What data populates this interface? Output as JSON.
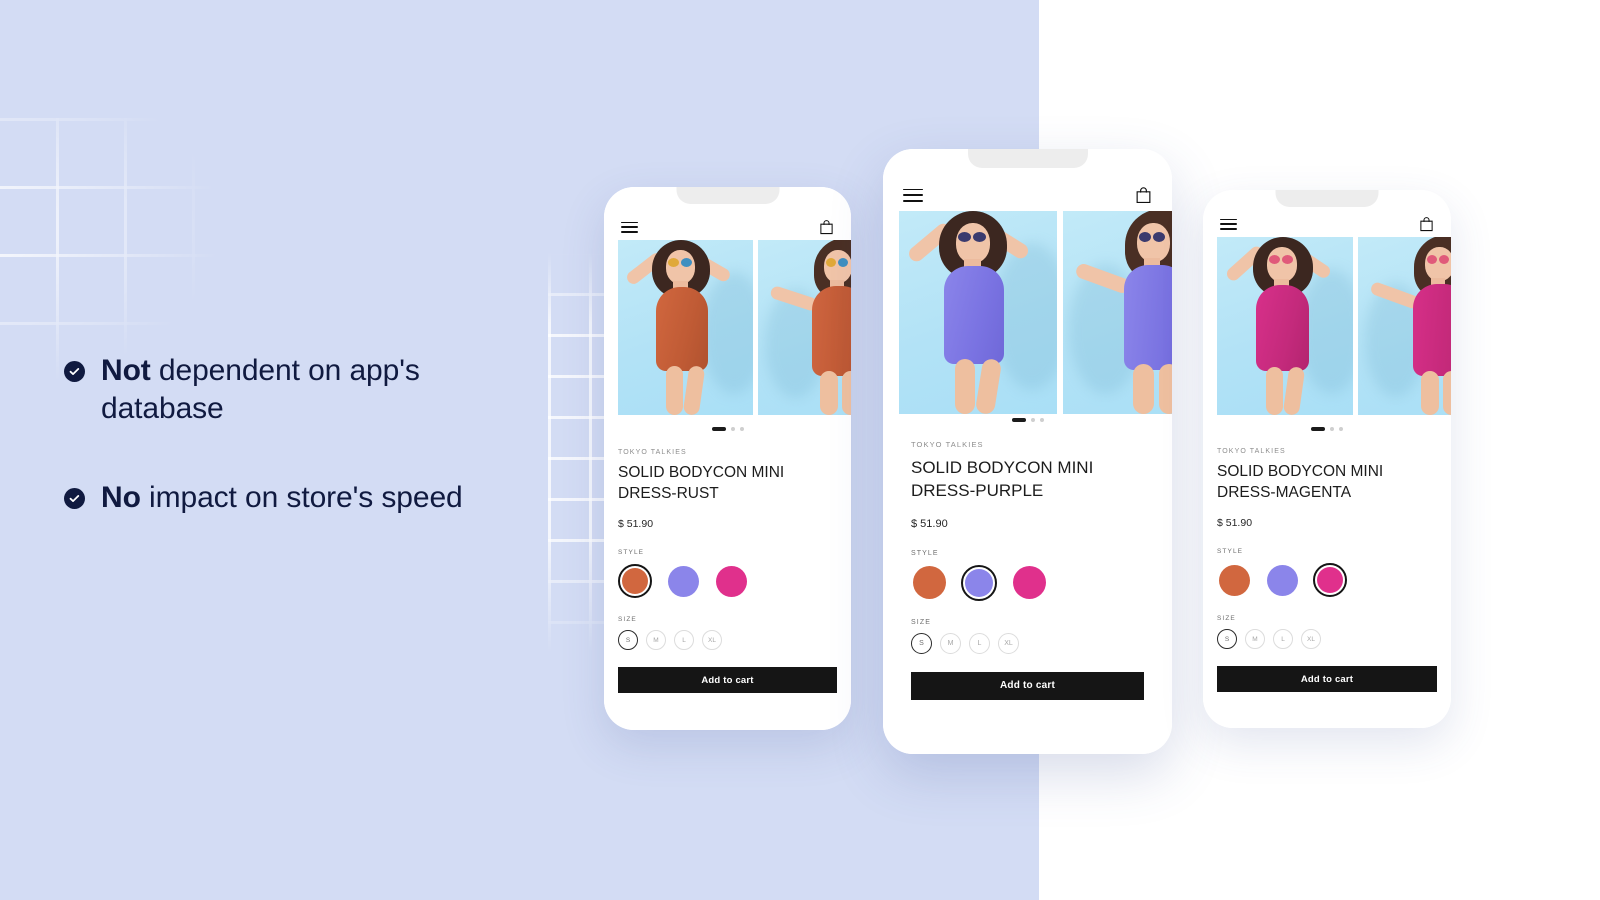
{
  "theme": {
    "bg_left": "#d3dcf4",
    "bg_right": "#ffffff",
    "navy": "#101a40",
    "button_bg": "#151515",
    "swatch_rust": "#d1673f",
    "swatch_purple": "#8b85ea",
    "swatch_magenta": "#e0308c"
  },
  "copy": {
    "bullets": [
      {
        "icon": "check-circle-icon",
        "strong": "Not",
        "rest": " dependent on app's database"
      },
      {
        "icon": "check-circle-icon",
        "strong": "No",
        "rest": " impact on store's speed"
      }
    ]
  },
  "phones": [
    {
      "id": "phone-rust",
      "header": {
        "menu_icon": "hamburger-menu-icon",
        "cart_icon": "shopping-bag-icon"
      },
      "pager": {
        "active_index": 0,
        "count": 3
      },
      "product": {
        "brand": "TOKYO TALKIES",
        "title": "SOLID BODYCON MINI DRESS-RUST",
        "price": "$ 51.90",
        "style_label": "STYLE",
        "size_label": "SIZE",
        "selected_style_index": 0,
        "selected_size_index": 0,
        "styles": [
          {
            "name": "rust",
            "color": "#d1673f"
          },
          {
            "name": "purple",
            "color": "#8b85ea"
          },
          {
            "name": "magenta",
            "color": "#e0308c"
          }
        ],
        "sizes": [
          "S",
          "M",
          "L",
          "XL"
        ],
        "add_to_cart": "Add to cart"
      }
    },
    {
      "id": "phone-purple",
      "header": {
        "menu_icon": "hamburger-menu-icon",
        "cart_icon": "shopping-bag-icon"
      },
      "pager": {
        "active_index": 0,
        "count": 3
      },
      "product": {
        "brand": "TOKYO TALKIES",
        "title": "SOLID BODYCON MINI DRESS-PURPLE",
        "price": "$ 51.90",
        "style_label": "STYLE",
        "size_label": "SIZE",
        "selected_style_index": 1,
        "selected_size_index": 0,
        "styles": [
          {
            "name": "rust",
            "color": "#d1673f"
          },
          {
            "name": "purple",
            "color": "#8b85ea"
          },
          {
            "name": "magenta",
            "color": "#e0308c"
          }
        ],
        "sizes": [
          "S",
          "M",
          "L",
          "XL"
        ],
        "add_to_cart": "Add to cart"
      }
    },
    {
      "id": "phone-magenta",
      "header": {
        "menu_icon": "hamburger-menu-icon",
        "cart_icon": "shopping-bag-icon"
      },
      "pager": {
        "active_index": 0,
        "count": 3
      },
      "product": {
        "brand": "TOKYO TALKIES",
        "title": "SOLID BODYCON MINI DRESS-MAGENTA",
        "price": "$ 51.90",
        "style_label": "STYLE",
        "size_label": "SIZE",
        "selected_style_index": 2,
        "selected_size_index": 0,
        "styles": [
          {
            "name": "rust",
            "color": "#d1673f"
          },
          {
            "name": "purple",
            "color": "#8b85ea"
          },
          {
            "name": "magenta",
            "color": "#e0308c"
          }
        ],
        "sizes": [
          "S",
          "M",
          "L",
          "XL"
        ],
        "add_to_cart": "Add to cart"
      }
    }
  ]
}
